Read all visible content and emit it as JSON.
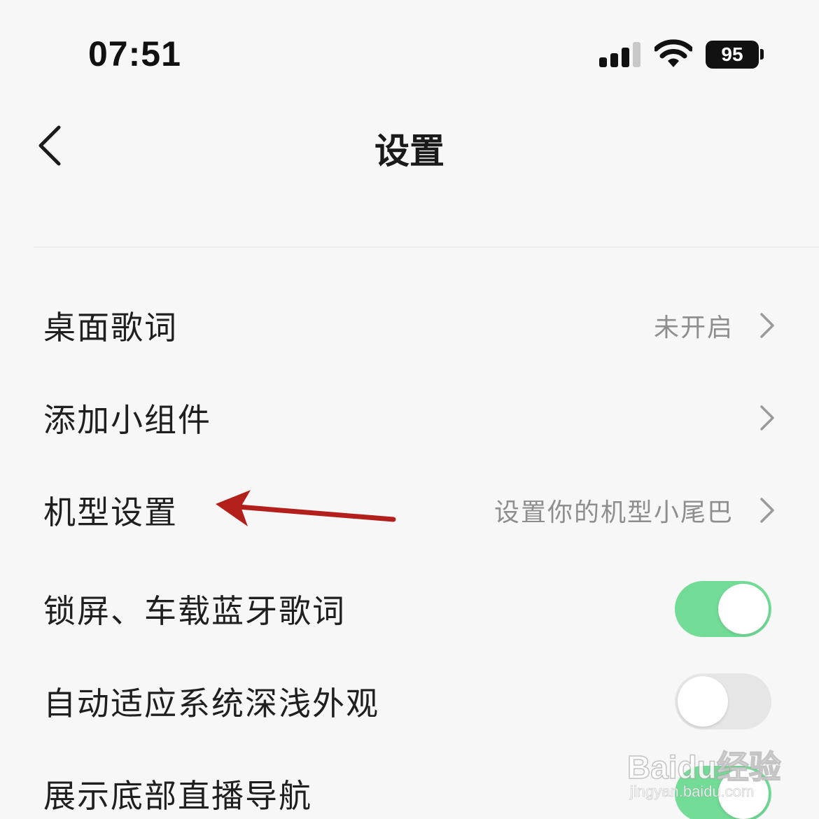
{
  "status_bar": {
    "time": "07:51",
    "battery": "95",
    "icons": [
      "signal-icon",
      "wifi-icon",
      "battery-icon"
    ]
  },
  "header": {
    "title": "设置",
    "back_icon": "chevron-left-icon"
  },
  "rows": [
    {
      "label": "桌面歌词",
      "value": "未开启",
      "control": "chevron"
    },
    {
      "label": "添加小组件",
      "value": "",
      "control": "chevron"
    },
    {
      "label": "机型设置",
      "value": "设置你的机型小尾巴",
      "control": "chevron"
    },
    {
      "label": "锁屏、车载蓝牙歌词",
      "control": "toggle",
      "on": true
    },
    {
      "label": "自动适应系统深浅外观",
      "control": "toggle",
      "on": false
    },
    {
      "label": "展示底部直播导航",
      "control": "toggle",
      "on": true
    }
  ],
  "annotation": {
    "icon": "red-arrow-icon",
    "color": "#b3201c"
  },
  "colors": {
    "toggle_on": "#72dc96",
    "toggle_off": "#e6e6e6",
    "background": "#f7f7f7"
  },
  "watermark": {
    "brand": "Baidu经验",
    "url": "jingyan.baidu.com"
  }
}
